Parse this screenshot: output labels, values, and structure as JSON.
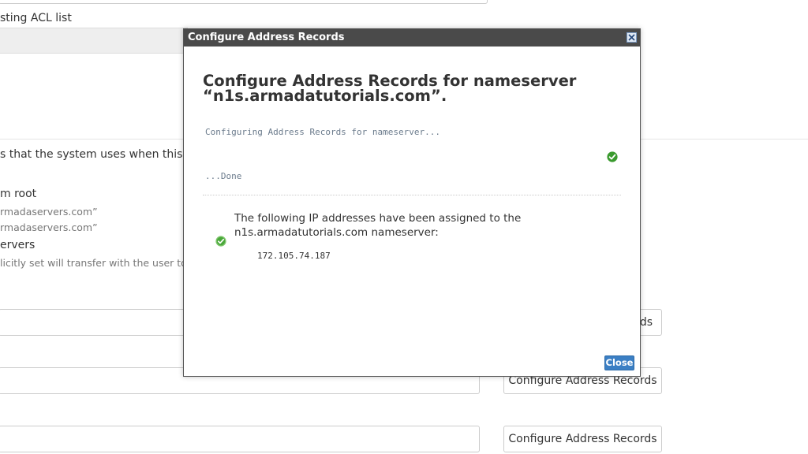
{
  "background": {
    "acl_label": "sting ACL list",
    "description_fragment": "s that the system uses when this res",
    "root_label": "m root",
    "server_line_1": "rmadaservers.com”",
    "server_line_2": "rmadaservers.com”",
    "servers_label": "ervers",
    "transfer_note": "licitly set will transfer with the user to t",
    "button_partial_label": "ds",
    "button_label_2": "Configure Address Records",
    "button_label_3": "Configure Address Records"
  },
  "modal": {
    "title": "Configure Address Records",
    "heading": "Configure Address Records for nameserver “n1s.armadatutorials.com”.",
    "progress_text": "Configuring Address Records for nameserver...",
    "done_text": "...Done",
    "result_text": "The following IP addresses have been assigned to the n1s.armadatutorials.com nameserver:",
    "ip_address": "172.105.74.187",
    "close_label": "Close",
    "icons": {
      "close": "close-icon",
      "success": "check-circle-icon"
    }
  },
  "colors": {
    "titlebar": "#4a4a4a",
    "success_green": "#3a9a2e",
    "close_button": "#3b7fc4"
  }
}
